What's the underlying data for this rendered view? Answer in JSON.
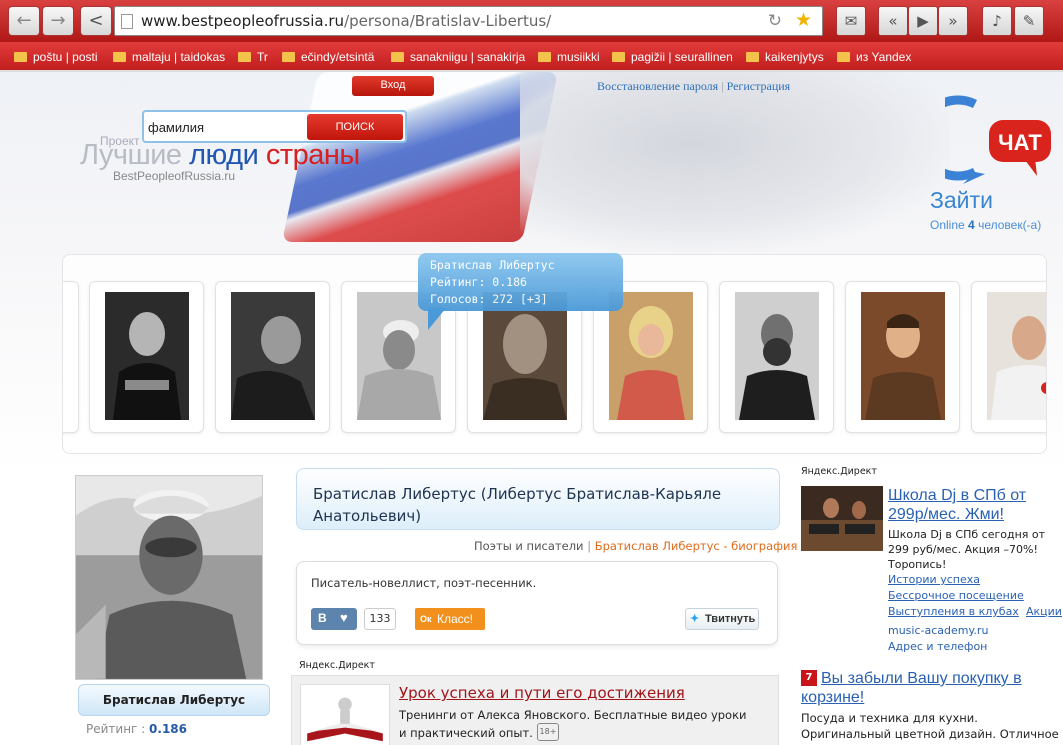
{
  "browser": {
    "url_domain": "www.bestpeopleofrussia.ru",
    "url_path": "/persona/Bratislav-Libertus/",
    "bookmarks": [
      {
        "label": "poštu | posti"
      },
      {
        "label": "maltaju | taidokas"
      },
      {
        "label": "Tr"
      },
      {
        "label": "ečindy/etsintä"
      },
      {
        "label": "sanakniigu | sanakirja"
      },
      {
        "label": "musiikki"
      },
      {
        "label": "pagižii | seurallinen"
      },
      {
        "label": "kaikenjytys"
      },
      {
        "label": "из Yandex"
      }
    ]
  },
  "header": {
    "login_button": "Вход",
    "recover_link": "Восстановление пароля",
    "link_separator": "|",
    "register_link": "Регистрация",
    "search_value": "фамилия",
    "search_button": "ПОИСК",
    "logo_project": "Проект",
    "logo_word1": "Лучшие",
    "logo_word2": "люди",
    "logo_word3": "страны",
    "logo_domain": "BestPeopleofRussia.ru"
  },
  "chat": {
    "logo_text": "ЧАТ",
    "login": "Зайти",
    "online_prefix": "Online",
    "online_count": "4",
    "online_suffix": "человек(-а)"
  },
  "gallery": {
    "tooltip_name": "Братислав Либертус",
    "tooltip_rating": "Рейтинг: 0.186",
    "tooltip_votes": "Голосов: 272 [+3]"
  },
  "profile": {
    "name_button": "Братислав Либертус",
    "rating_label": "Рейтинг :",
    "rating_value": "0.186"
  },
  "main": {
    "title": "Братислав Либертус (Либертус Братислав-Карьяле Анатольевич)",
    "crumb_category": "Поэты и писатели",
    "crumb_separator": "|",
    "crumb_bio": "Братислав Либертус - биография",
    "description": "Писатель-новеллист, поэт-песенник.",
    "vk_label": "В",
    "vk_count": "133",
    "ok_icon": "Ок",
    "ok_label": "Класс!",
    "tweet_label": "Твитнуть"
  },
  "ads": {
    "yandex_label": "Яндекс.Директ",
    "main_title": "Урок успеха и пути его достижения",
    "main_text": "Тренинги от Алекса Яновского. Бесплатные видео уроки и практический опыт.",
    "main_age": "18+",
    "right1_title": "Школа Dj в СПб от 299р/мес. Жми!",
    "right1_text": "Школа Dj в СПб сегодня от 299 руб/мес. Акция –70%! Торопись!",
    "right1_links": [
      "Истории успеха",
      "Бессрочное посещение",
      "Выступления в клубах",
      "Акции"
    ],
    "right1_domain": "music-academy.ru",
    "right1_address": "Адрес и телефон",
    "right2_title": "Вы забыли Вашу покупку в корзине!",
    "right2_text": "Посуда и техника для кухни. Оригинальный цветной дизайн. Отличное качество!"
  },
  "colors": {
    "chrome_red": "#c21f1f",
    "logo_blue": "#2057b0",
    "logo_red": "#d82020",
    "link_blue": "#2a61b4",
    "bio_orange": "#e06b1c"
  }
}
